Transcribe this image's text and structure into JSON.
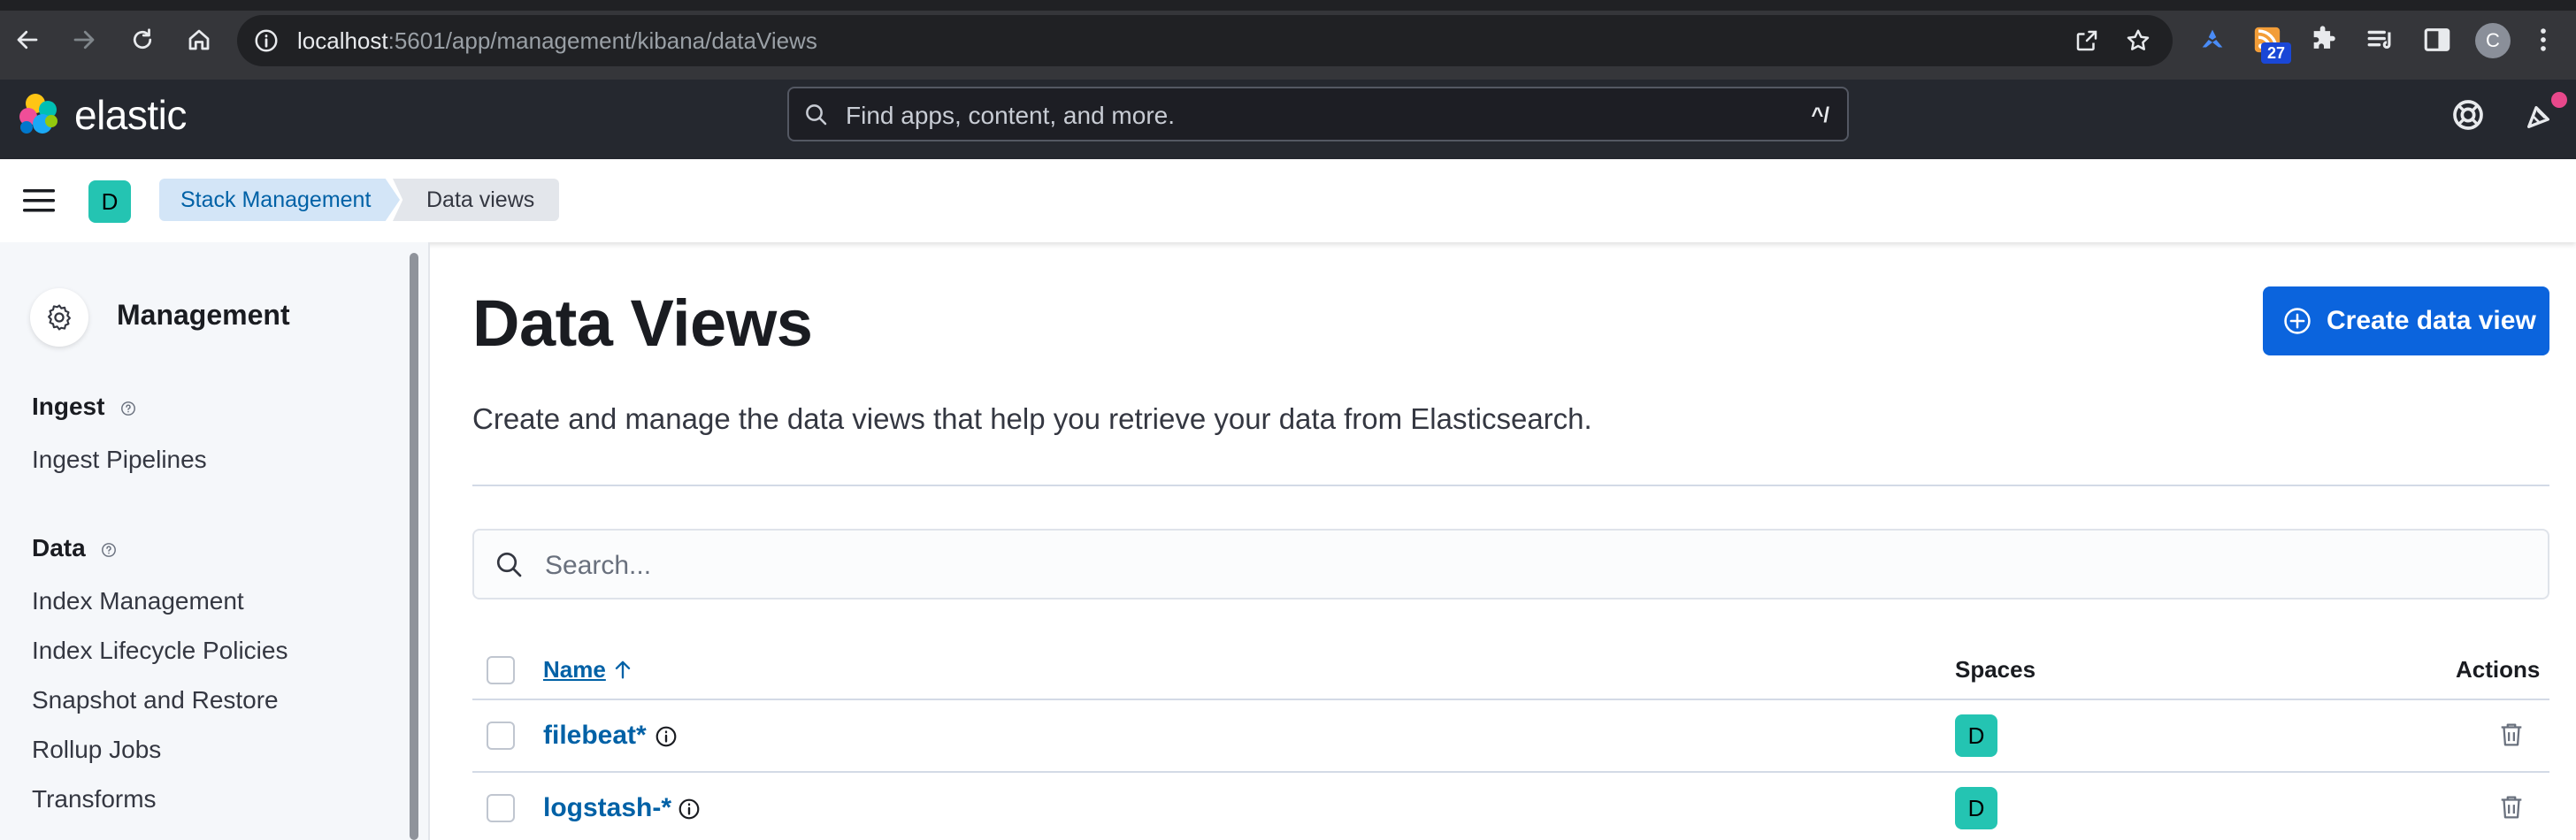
{
  "browser": {
    "url_host": "localhost",
    "url_rest": ":5601/app/management/kibana/dataViews",
    "extension_badge": "27",
    "profile_initial": "C"
  },
  "header": {
    "logo_text": "elastic",
    "search_placeholder": "Find apps, content, and more.",
    "search_shortcut": "^/"
  },
  "breadcrumbs": {
    "space_initial": "D",
    "items": [
      "Stack Management",
      "Data views"
    ]
  },
  "sidebar": {
    "title": "Management",
    "sections": [
      {
        "heading": "Ingest",
        "items": [
          "Ingest Pipelines"
        ]
      },
      {
        "heading": "Data",
        "items": [
          "Index Management",
          "Index Lifecycle Policies",
          "Snapshot and Restore",
          "Rollup Jobs",
          "Transforms"
        ]
      }
    ]
  },
  "main": {
    "title": "Data Views",
    "create_button": "Create data view",
    "description": "Create and manage the data views that help you retrieve your data from Elasticsearch.",
    "search_placeholder": "Search...",
    "table": {
      "columns": [
        "Name",
        "Spaces",
        "Actions"
      ],
      "rows": [
        {
          "name": "filebeat*",
          "space": "D"
        },
        {
          "name": "logstash-*",
          "space": "D"
        }
      ]
    }
  },
  "colors": {
    "accent": "#0b64dd",
    "link": "#0061a6",
    "space_avatar": "#24c4b2",
    "header_bg": "#25282f"
  }
}
